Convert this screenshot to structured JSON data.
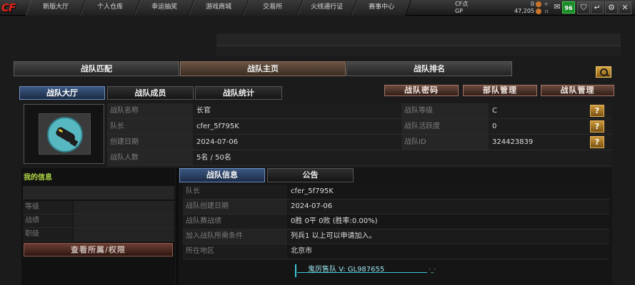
{
  "nav": {
    "logo": "CF",
    "tabs": [
      "新版大厅",
      "个人仓库",
      "幸运抽奖",
      "游戏商城",
      "交易所",
      "火线通行证",
      "赛事中心"
    ]
  },
  "currency": {
    "cf_label": "CF点",
    "cf_value": "0",
    "gp_label": "GP",
    "gp_value": "47,205"
  },
  "top_icons": {
    "mail_badge": "96"
  },
  "main_tabs": [
    "战队匹配",
    "战队主页",
    "战队排名"
  ],
  "sub_tabs": [
    "战队大厅",
    "战队成员",
    "战队统计"
  ],
  "mgmt_buttons": [
    "战队密码",
    "部队管理",
    "战队管理"
  ],
  "clan_info": {
    "rows": [
      {
        "label": "战队名称",
        "value": "长官",
        "label2": "战队等级",
        "value2": "C",
        "help": "?"
      },
      {
        "label": "队长",
        "value": "cfer_5f795K",
        "label2": "战队活跃度",
        "value2": "0",
        "help": "?"
      },
      {
        "label": "创建日期",
        "value": "2024-07-06",
        "label2": "战队ID",
        "value2": "324423839",
        "help": "?"
      },
      {
        "label": "战队人数",
        "value": "5名 / 50名"
      }
    ]
  },
  "my_info": {
    "title": "我的信息",
    "rows": [
      "等级",
      "战绩",
      "职级"
    ],
    "view_button": "查看所属/权限"
  },
  "lower_tabs": [
    "战队信息",
    "公告"
  ],
  "details": {
    "rows": [
      {
        "label": "队长",
        "value": "cfer_5f795K"
      },
      {
        "label": "战队创建日期",
        "value": "2024-07-06"
      },
      {
        "label": "战队赛战绩",
        "value": "0胜 0平 0败 (胜率:0.00%)"
      },
      {
        "label": "加入战队所需条件",
        "value": "列兵1 以上可以申请加入。"
      },
      {
        "label": "所在地区",
        "value": "北京市"
      }
    ]
  },
  "notice": {
    "text": "鬼厉售队 V:  GL987655",
    "tail": "·_·"
  }
}
